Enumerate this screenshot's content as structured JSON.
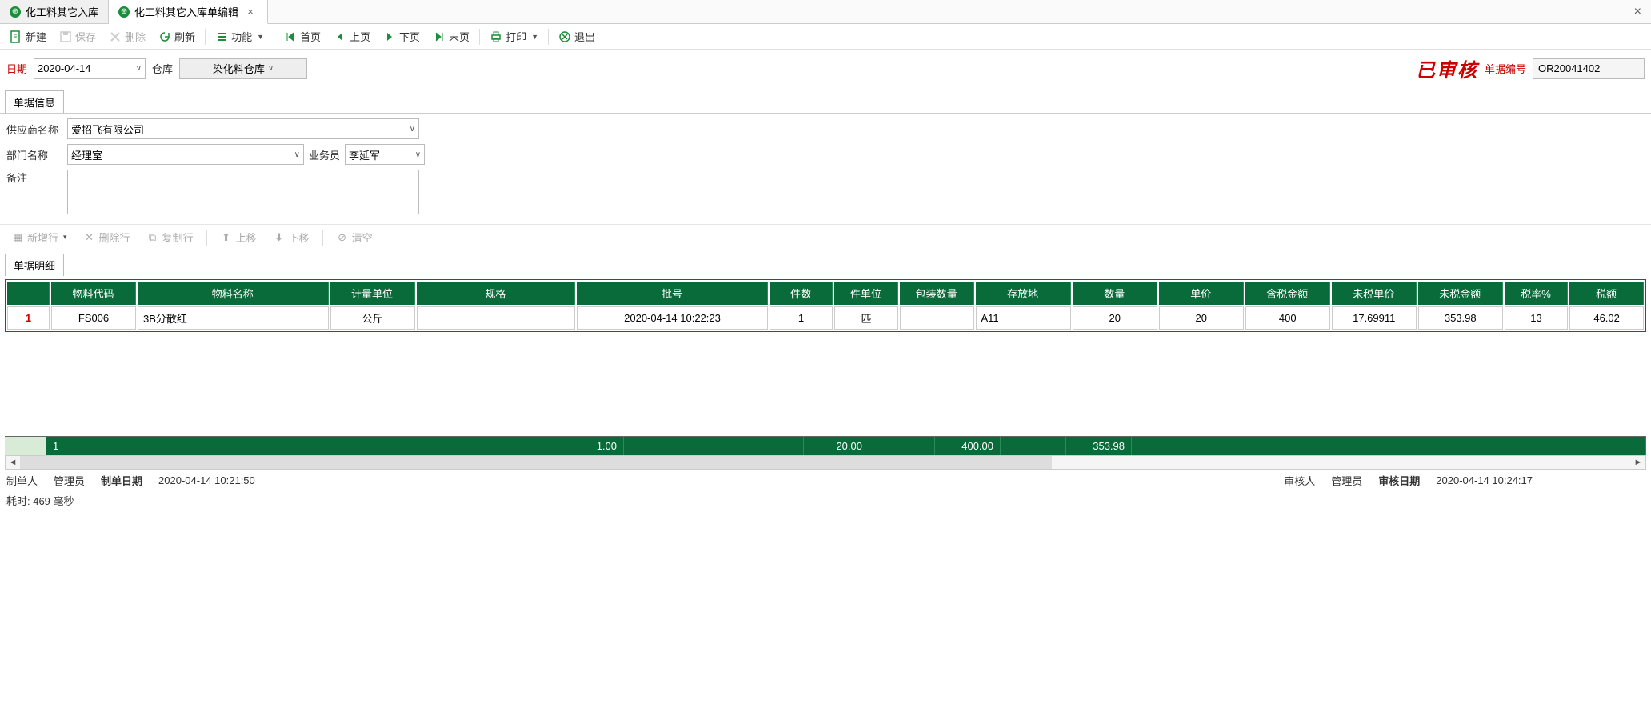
{
  "tabs": [
    {
      "title": "化工料其它入库"
    },
    {
      "title": "化工料其它入库单编辑"
    }
  ],
  "toolbar": {
    "new": "新建",
    "save": "保存",
    "delete": "删除",
    "refresh": "刷新",
    "func": "功能",
    "first": "首页",
    "prev": "上页",
    "next": "下页",
    "last": "末页",
    "print": "打印",
    "exit": "退出"
  },
  "header": {
    "date_label": "日期",
    "date_value": "2020-04-14",
    "warehouse_label": "仓库",
    "warehouse_value": "染化料仓库",
    "approved_stamp": "已审核",
    "doc_no_label": "单据编号",
    "doc_no_value": "OR20041402"
  },
  "info": {
    "section_title": "单据信息",
    "supplier_label": "供应商名称",
    "supplier_value": "爱招飞有限公司",
    "dept_label": "部门名称",
    "dept_value": "经理室",
    "salesman_label": "业务员",
    "salesman_value": "李延军",
    "remark_label": "备注",
    "remark_value": ""
  },
  "detail_toolbar": {
    "add_row": "新增行",
    "del_row": "删除行",
    "copy_row": "复制行",
    "move_up": "上移",
    "move_down": "下移",
    "clear": "清空"
  },
  "detail": {
    "section_title": "单据明细",
    "columns": [
      "物料代码",
      "物料名称",
      "计量单位",
      "规格",
      "批号",
      "件数",
      "件单位",
      "包装数量",
      "存放地",
      "数量",
      "单价",
      "含税金额",
      "未税单价",
      "未税金额",
      "税率%",
      "税额"
    ],
    "rows": [
      {
        "rownum": "1",
        "material_code": "FS006",
        "material_name": "3B分散红",
        "uom": "公斤",
        "spec": "",
        "batch": "2020-04-14 10:22:23",
        "piece_qty": "1",
        "piece_uom": "匹",
        "pack_qty": "",
        "location": "A11",
        "qty": "20",
        "price": "20",
        "amount_tax": "400",
        "price_notax": "17.69911",
        "amount_notax": "353.98",
        "tax_rate": "13",
        "tax_amount": "46.02"
      }
    ],
    "summary": {
      "count": "1",
      "piece_qty": "1.00",
      "qty": "20.00",
      "amount_tax": "400.00",
      "amount_notax": "353.98"
    }
  },
  "status": {
    "maker_label": "制单人",
    "maker_value": "管理员",
    "make_date_label": "制单日期",
    "make_date_value": "2020-04-14 10:21:50",
    "auditor_label": "审核人",
    "auditor_value": "管理员",
    "audit_date_label": "审核日期",
    "audit_date_value": "2020-04-14 10:24:17",
    "timing": "耗时: 469 毫秒"
  }
}
